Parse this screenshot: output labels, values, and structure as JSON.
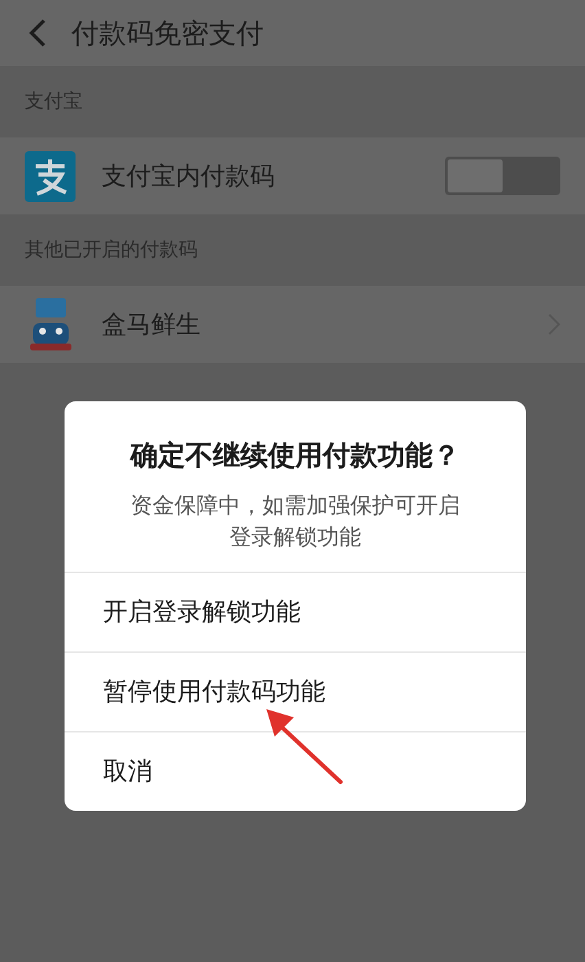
{
  "header": {
    "title": "付款码免密支付"
  },
  "sections": [
    {
      "label": "支付宝",
      "items": [
        {
          "kind": "toggle",
          "label": "支付宝内付款码",
          "on": false
        }
      ]
    },
    {
      "label": "其他已开启的付款码",
      "items": [
        {
          "kind": "link",
          "label": "盒马鲜生"
        }
      ]
    }
  ],
  "dialog": {
    "title": "确定不继续使用付款功能？",
    "message": "资金保障中，如需加强保护可开启登录解锁功能",
    "options": [
      "开启登录解锁功能",
      "暂停使用付款码功能",
      "取消"
    ]
  }
}
